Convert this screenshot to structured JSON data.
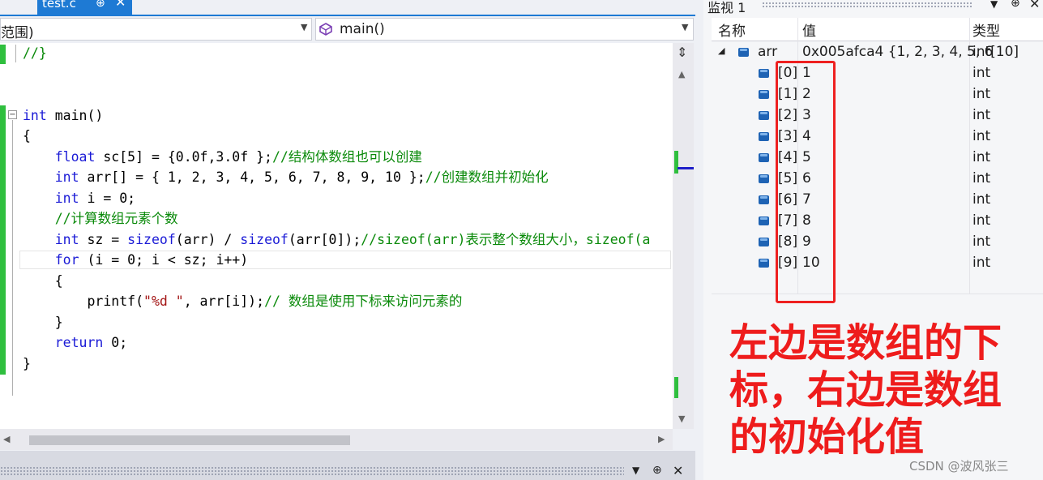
{
  "editor_tab": {
    "label": "test.c",
    "pin": "⊕",
    "close": "✕"
  },
  "nav": {
    "scope_label": "范围)",
    "function_label": "main()"
  },
  "code_lines": [
    {
      "segments": [
        {
          "c": "cm",
          "t": "//}"
        }
      ]
    },
    {
      "segments": []
    },
    {
      "segments": []
    },
    {
      "segments": [
        {
          "c": "kw",
          "t": "int"
        },
        {
          "c": "",
          "t": " main()"
        }
      ]
    },
    {
      "segments": [
        {
          "c": "",
          "t": "{"
        }
      ]
    },
    {
      "segments": [
        {
          "c": "",
          "t": "    "
        },
        {
          "c": "kw",
          "t": "float"
        },
        {
          "c": "",
          "t": " sc[5] = {0.0f,3.0f };"
        },
        {
          "c": "cm",
          "t": "//结构体数组也可以创建"
        }
      ]
    },
    {
      "segments": [
        {
          "c": "",
          "t": "    "
        },
        {
          "c": "kw",
          "t": "int"
        },
        {
          "c": "",
          "t": " arr[] = { 1, 2, 3, 4, 5, 6, 7, 8, 9, 10 };"
        },
        {
          "c": "cm",
          "t": "//创建数组并初始化"
        }
      ]
    },
    {
      "segments": [
        {
          "c": "",
          "t": "    "
        },
        {
          "c": "kw",
          "t": "int"
        },
        {
          "c": "",
          "t": " i = 0;"
        }
      ]
    },
    {
      "segments": [
        {
          "c": "",
          "t": "    "
        },
        {
          "c": "cm",
          "t": "//计算数组元素个数"
        }
      ]
    },
    {
      "segments": [
        {
          "c": "",
          "t": "    "
        },
        {
          "c": "kw",
          "t": "int"
        },
        {
          "c": "",
          "t": " sz = "
        },
        {
          "c": "kw",
          "t": "sizeof"
        },
        {
          "c": "",
          "t": "(arr) / "
        },
        {
          "c": "kw",
          "t": "sizeof"
        },
        {
          "c": "",
          "t": "(arr[0]);"
        },
        {
          "c": "cm",
          "t": "//sizeof(arr)表示整个数组大小，sizeof(a"
        }
      ]
    },
    {
      "segments": [
        {
          "c": "",
          "t": "    "
        },
        {
          "c": "kw",
          "t": "for"
        },
        {
          "c": "",
          "t": " (i = 0; i < sz; i++)"
        }
      ]
    },
    {
      "segments": [
        {
          "c": "",
          "t": "    {"
        }
      ]
    },
    {
      "segments": [
        {
          "c": "",
          "t": "        printf("
        },
        {
          "c": "st",
          "t": "\"%d \""
        },
        {
          "c": "",
          "t": ", arr[i]);"
        },
        {
          "c": "cm",
          "t": "// 数组是使用下标来访问元素的"
        }
      ]
    },
    {
      "segments": [
        {
          "c": "",
          "t": "    }"
        }
      ]
    },
    {
      "segments": [
        {
          "c": "",
          "t": "    "
        },
        {
          "c": "kw",
          "t": "return"
        },
        {
          "c": "",
          "t": " 0;"
        }
      ]
    },
    {
      "segments": [
        {
          "c": "",
          "t": "}"
        }
      ]
    }
  ],
  "watch": {
    "title": "监视 1",
    "headers": {
      "name": "名称",
      "value": "值",
      "type": "类型"
    },
    "root": {
      "name": "arr",
      "value": "0x005afca4 {1, 2, 3, 4, 5, 6",
      "type": "int[10]"
    },
    "items": [
      {
        "name": "[0]",
        "value": "1",
        "type": "int"
      },
      {
        "name": "[1]",
        "value": "2",
        "type": "int"
      },
      {
        "name": "[2]",
        "value": "3",
        "type": "int"
      },
      {
        "name": "[3]",
        "value": "4",
        "type": "int"
      },
      {
        "name": "[4]",
        "value": "5",
        "type": "int"
      },
      {
        "name": "[5]",
        "value": "6",
        "type": "int"
      },
      {
        "name": "[6]",
        "value": "7",
        "type": "int"
      },
      {
        "name": "[7]",
        "value": "8",
        "type": "int"
      },
      {
        "name": "[8]",
        "value": "9",
        "type": "int"
      },
      {
        "name": "[9]",
        "value": "10",
        "type": "int"
      }
    ]
  },
  "annotation": "左边是数组的下标，右边是数组的初始化值",
  "watermark": "CSDN @波风张三",
  "colors": {
    "accent": "#1e7ad4",
    "keyword": "#1a1ad6",
    "comment": "#0a8a0a",
    "string": "#a31515",
    "annotation": "#ee1c1c",
    "gutter_green": "#2fbf3e"
  }
}
